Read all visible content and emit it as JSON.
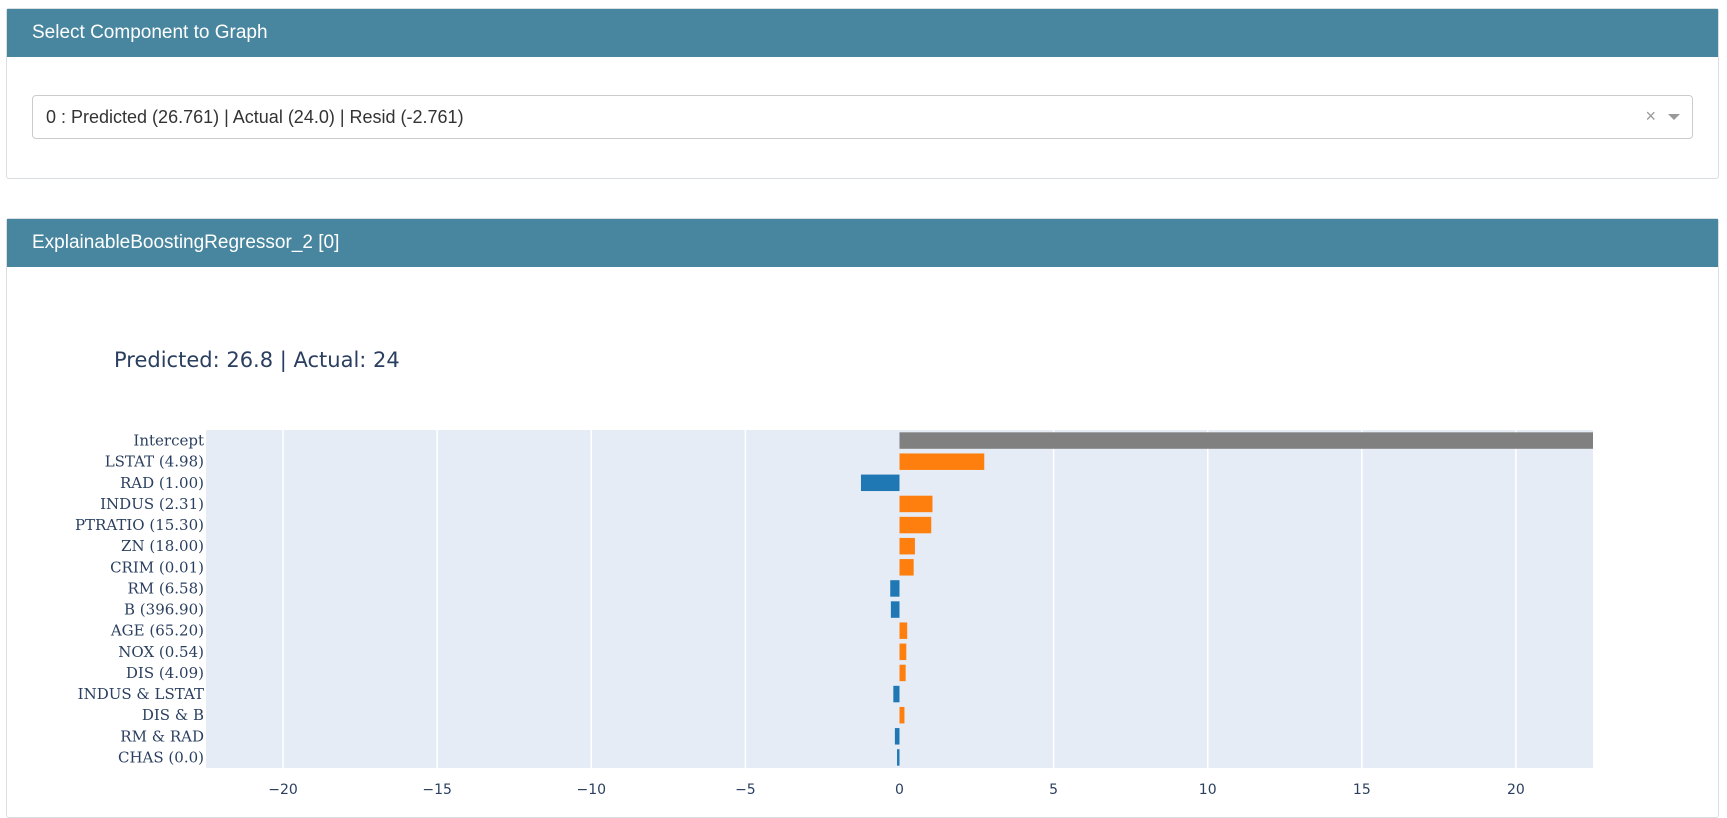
{
  "select_panel": {
    "header": "Select Component to Graph",
    "selected_value": "0 : Predicted (26.761) | Actual (24.0) | Resid (-2.761)",
    "clear_glyph": "×"
  },
  "graph_panel": {
    "header": "ExplainableBoostingRegressor_2 [0]"
  },
  "colors": {
    "header_bg": "#48869f",
    "plot_bg": "#e5ecf6",
    "positive": "#ff7f0e",
    "negative": "#1f77b4",
    "intercept": "#808080"
  },
  "chart_data": {
    "type": "bar",
    "orientation": "horizontal",
    "title": "Predicted: 26.8 | Actual: 24",
    "xlabel": "",
    "ylabel": "",
    "xlim": [
      -22.5,
      22.5
    ],
    "x_ticks": [
      -20,
      -15,
      -10,
      -5,
      0,
      5,
      10,
      15,
      20
    ],
    "x_tick_labels": [
      "−20",
      "−15",
      "−10",
      "−5",
      "0",
      "5",
      "10",
      "15",
      "20"
    ],
    "grid": true,
    "categories": [
      "Intercept",
      "LSTAT (4.98)",
      "RAD (1.00)",
      "INDUS (2.31)",
      "PTRATIO (15.30)",
      "ZN (18.00)",
      "CRIM (0.01)",
      "RM (6.58)",
      "B (396.90)",
      "AGE (65.20)",
      "NOX (0.54)",
      "DIS (4.09)",
      "INDUS & LSTAT",
      "DIS & B",
      "RM & RAD",
      "CHAS (0.0)"
    ],
    "values": [
      22.5,
      2.75,
      -1.25,
      1.07,
      1.03,
      0.5,
      0.46,
      -0.3,
      -0.28,
      0.25,
      0.22,
      0.2,
      -0.2,
      0.16,
      -0.15,
      -0.08
    ]
  }
}
